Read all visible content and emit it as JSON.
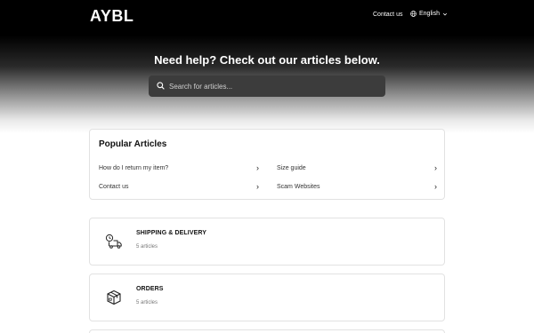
{
  "header": {
    "logo": "AYBL",
    "contact_label": "Contact us",
    "language_label": "English"
  },
  "hero": {
    "title": "Need help? Check out our articles below.",
    "search_placeholder": "Search for articles..."
  },
  "popular": {
    "heading": "Popular Articles",
    "articles": [
      {
        "label": "How do I return my item?"
      },
      {
        "label": "Size guide"
      },
      {
        "label": "Contact us"
      },
      {
        "label": "Scam Websites"
      }
    ]
  },
  "categories": [
    {
      "title": "SHIPPING & DELIVERY",
      "count": "5 articles",
      "icon": "delivery-truck-icon"
    },
    {
      "title": "ORDERS",
      "count": "5 articles",
      "icon": "package-box-icon"
    }
  ],
  "colors": {
    "header_bg": "#000000",
    "search_bg": "#3c3c3c",
    "card_border": "#e2e2e2"
  }
}
